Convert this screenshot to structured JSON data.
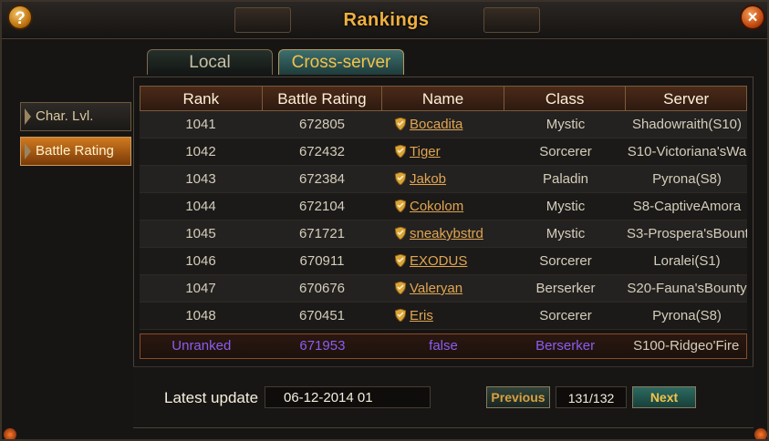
{
  "window": {
    "title": "Rankings",
    "help_label": "?",
    "close_label": "×"
  },
  "tabs": [
    {
      "label": "Local",
      "active": false
    },
    {
      "label": "Cross-server",
      "active": true
    }
  ],
  "sidebar": {
    "items": [
      {
        "label": "Char. Lvl.",
        "active": false
      },
      {
        "label": "Battle Rating",
        "active": true
      }
    ]
  },
  "table": {
    "headers": [
      "Rank",
      "Battle Rating",
      "Name",
      "Class",
      "Server"
    ],
    "rows": [
      {
        "rank": "1041",
        "rating": "672805",
        "name": "Bocadita",
        "class": "Mystic",
        "server": "Shadowraith(S10)"
      },
      {
        "rank": "1042",
        "rating": "672432",
        "name": "Tiger",
        "class": "Sorcerer",
        "server": "S10-Victoriana'sWa"
      },
      {
        "rank": "1043",
        "rating": "672384",
        "name": "Jakob",
        "class": "Paladin",
        "server": "Pyrona(S8)"
      },
      {
        "rank": "1044",
        "rating": "672104",
        "name": "Cokolom",
        "class": "Mystic",
        "server": "S8-CaptiveAmora"
      },
      {
        "rank": "1045",
        "rating": "671721",
        "name": "sneakybstrd",
        "class": "Mystic",
        "server": "S3-Prospera'sBount"
      },
      {
        "rank": "1046",
        "rating": "670911",
        "name": "EXODUS",
        "class": "Sorcerer",
        "server": "Loralei(S1)"
      },
      {
        "rank": "1047",
        "rating": "670676",
        "name": "Valeryan",
        "class": "Berserker",
        "server": "S20-Fauna'sBounty"
      },
      {
        "rank": "1048",
        "rating": "670451",
        "name": "Eris",
        "class": "Sorcerer",
        "server": "Pyrona(S8)"
      }
    ],
    "self_row": {
      "rank": "Unranked",
      "rating": "671953",
      "name": "false",
      "class": "Berserker",
      "server": "S100-Ridgeo'Fire"
    }
  },
  "footer": {
    "update_label": "Latest update",
    "update_value": "06-12-2014 01",
    "prev_label": "Previous",
    "page": "131/132",
    "next_label": "Next"
  },
  "colors": {
    "accent": "#f0b040",
    "link": "#e0a552",
    "self_row_text": "#8c5cf0"
  }
}
